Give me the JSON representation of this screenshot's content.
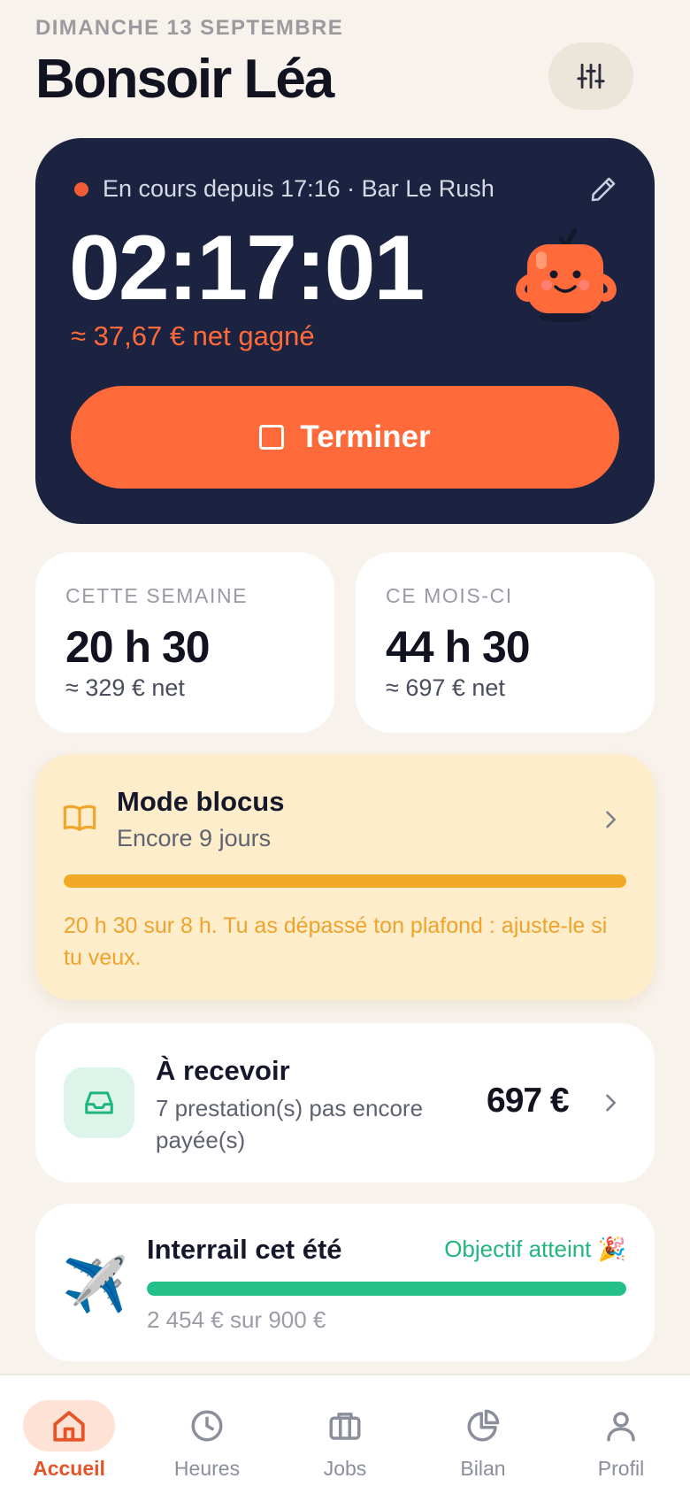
{
  "header": {
    "date": "DIMANCHE 13 SEPTEMBRE",
    "greeting": "Bonsoir Léa",
    "settings_icon": "sliders-icon"
  },
  "session": {
    "status_text": "En cours depuis 17:16 · Bar Le Rush",
    "timer": "02:17:01",
    "earned": "≈ 37,67 € net gagné",
    "finish_label": "Terminer",
    "edit_icon": "pencil-icon",
    "mascot_icon": "orange-mascot-icon",
    "accent": "#ff6a3a",
    "card_color": "#1b2340"
  },
  "stats": {
    "week": {
      "label": "CETTE SEMAINE",
      "value": "20 h 30",
      "net": "≈ 329 € net"
    },
    "month": {
      "label": "CE MOIS-CI",
      "value": "44 h 30",
      "net": "≈ 697 € net"
    }
  },
  "blocus": {
    "title": "Mode blocus",
    "subtitle": "Encore 9 jours",
    "progress": 1.0,
    "note": "20 h 30 sur 8 h. Tu as dépassé ton plafond : ajuste-le si tu veux.",
    "icon": "book-icon",
    "accent": "#f3a928"
  },
  "receivable": {
    "title": "À recevoir",
    "subtitle": "7 prestation(s) pas encore payée(s)",
    "amount": "697 €",
    "icon": "inbox-icon"
  },
  "goal": {
    "icon": "✈️",
    "title": "Interrail cet été",
    "status": "Objectif atteint 🎉",
    "progress": 1.0,
    "amount": "2 454 € sur 900 €",
    "accent": "#24c08a"
  },
  "tabbar": {
    "tabs": [
      {
        "label": "Accueil",
        "icon": "home-icon",
        "active": true
      },
      {
        "label": "Heures",
        "icon": "clock-icon",
        "active": false
      },
      {
        "label": "Jobs",
        "icon": "briefcase-icon",
        "active": false
      },
      {
        "label": "Bilan",
        "icon": "pie-chart-icon",
        "active": false
      },
      {
        "label": "Profil",
        "icon": "user-icon",
        "active": false
      }
    ]
  }
}
